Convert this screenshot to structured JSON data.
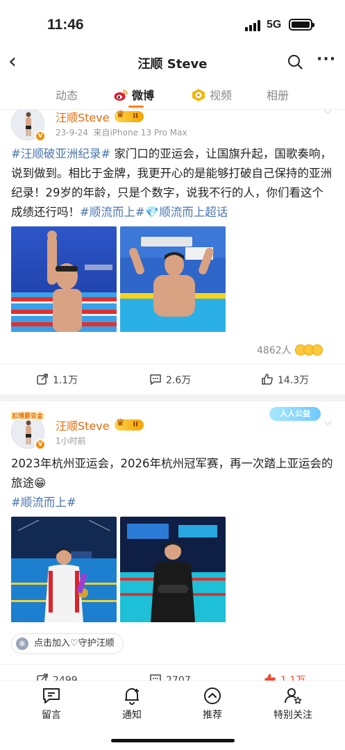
{
  "status": {
    "time": "11:46",
    "network": "5G"
  },
  "nav": {
    "title": "汪顺 Steve"
  },
  "tabs": [
    {
      "label": "动态"
    },
    {
      "label": "微博"
    },
    {
      "label": "视频"
    },
    {
      "label": "相册"
    }
  ],
  "posts": [
    {
      "username": "汪顺Steve",
      "vip_level": "II",
      "date": "23-9-24",
      "source": "来自iPhone 13 Pro Max",
      "text_parts": [
        {
          "t": "#汪顺破亚洲纪录#",
          "tag": true
        },
        {
          "t": " 家门口的亚运会，让国旗升起，国歌奏响，说到做到。相比于金牌，我更开心的是能够打破自己保持的亚洲纪录！29岁的年龄，只是个数字，说我不行的人，你们看这个成绩还行吗！",
          "tag": false
        },
        {
          "t": "#顺流而上#",
          "tag": true
        },
        {
          "t": "💎顺流而上超话",
          "tag": true
        }
      ],
      "like_summary": "4862人",
      "repost": "1.1万",
      "comment": "2.6万",
      "like": "14.3万"
    },
    {
      "username": "汪顺Steve",
      "vip_level": "II",
      "time_ago": "1小时前",
      "avatar_frame_text": "扣博爵亚金",
      "welfare_label": "人人公益",
      "text_line1": "2023年杭州亚运会，2026年杭州冠军赛，再一次踏上亚运会的旅途😁",
      "hashtag": "#顺流而上#",
      "join_chip": "点击加入♡守护汪顺",
      "repost": "2499",
      "comment": "2707",
      "like": "1.1万"
    }
  ],
  "bottom_bar": [
    {
      "label": "留言"
    },
    {
      "label": "通知"
    },
    {
      "label": "推荐"
    },
    {
      "label": "特别关注"
    }
  ],
  "colors": {
    "accent": "#ff8200",
    "username": "#e86a0c",
    "hashtag": "#4a74b0",
    "liked": "#f04b2f"
  }
}
